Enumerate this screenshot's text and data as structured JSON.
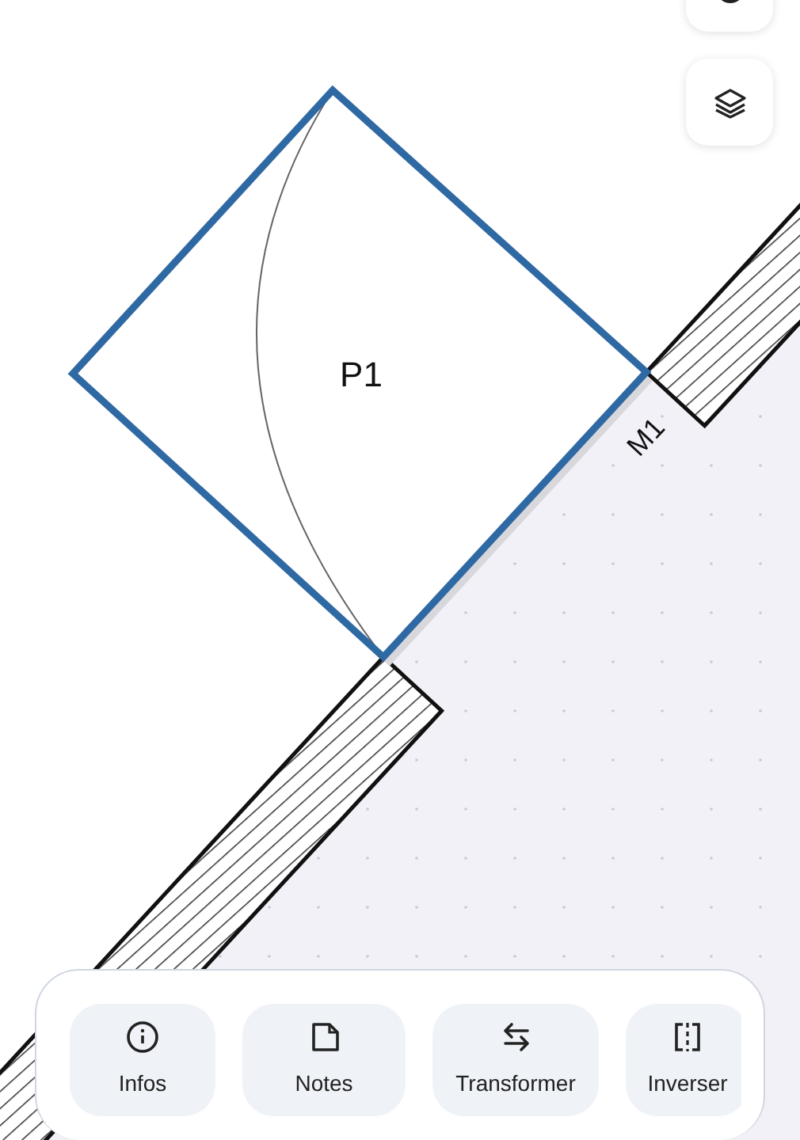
{
  "plan": {
    "door": {
      "label": "P1",
      "selected": true
    },
    "wall": {
      "label": "M1"
    }
  },
  "toolbar": {
    "items": [
      {
        "label": "Infos"
      },
      {
        "label": "Notes"
      },
      {
        "label": "Transformer"
      },
      {
        "label": "Inverser"
      }
    ]
  }
}
